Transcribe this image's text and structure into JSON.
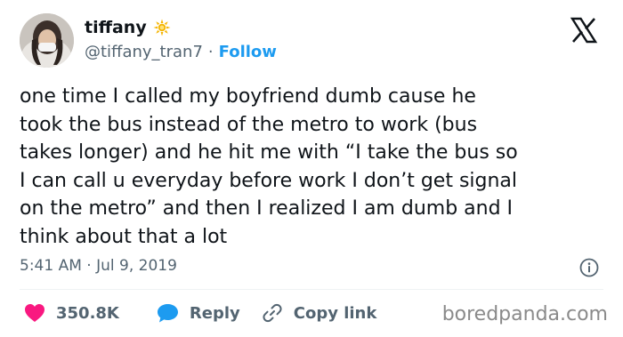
{
  "author": {
    "display_name": "tiffany",
    "handle": "@tiffany_tran7",
    "separator": "·",
    "follow_label": "Follow"
  },
  "icons": {
    "verified_badge": "sun-badge-icon",
    "brand": "x-logo-icon",
    "info": "info-icon",
    "like": "heart-icon",
    "reply": "speech-bubble-icon",
    "copy": "link-icon"
  },
  "tweet": {
    "text": "one time I called my boyfriend dumb cause he\ntook the bus instead of the metro to work (bus\ntakes longer) and he hit me with “I take the bus so\nI can call u everyday before work I don’t get signal\non the metro” and then I realized I am dumb and I\nthink about that a lot",
    "timestamp": "5:41 AM · Jul 9, 2019"
  },
  "actions": {
    "likes": "350.8K",
    "reply_label": "Reply",
    "copy_link_label": "Copy link"
  },
  "watermark": "boredpanda.com",
  "colors": {
    "link_blue": "#1d9bf0",
    "heart_pink": "#f91880",
    "secondary_text": "#536471",
    "badge_yellow": "#f4c430"
  }
}
